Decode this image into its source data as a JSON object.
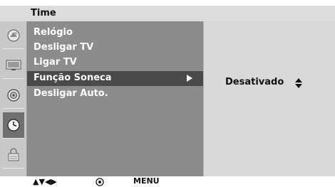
{
  "header": {
    "title": "Time"
  },
  "sidebar": {
    "icons": [
      {
        "name": "picture-icon"
      },
      {
        "name": "screen-icon"
      },
      {
        "name": "audio-icon"
      },
      {
        "name": "clock-icon"
      },
      {
        "name": "lock-icon"
      }
    ],
    "selected_index": 3
  },
  "menu": {
    "items": [
      {
        "label": "Relógio"
      },
      {
        "label": "Desligar TV"
      },
      {
        "label": "Ligar TV"
      },
      {
        "label": "Função Soneca"
      },
      {
        "label": "Desligar Auto."
      }
    ],
    "highlighted_index": 3
  },
  "value_panel": {
    "value": "Desativado"
  },
  "footer": {
    "nav_arrows": "▲▼◀▶",
    "menu_label": "MENU"
  },
  "colors": {
    "menu_bg": "#8c8c8c",
    "highlight_bg": "#4a4a4a",
    "value_bg": "#d9d9d9",
    "title_bg": "#dcdcdc"
  }
}
